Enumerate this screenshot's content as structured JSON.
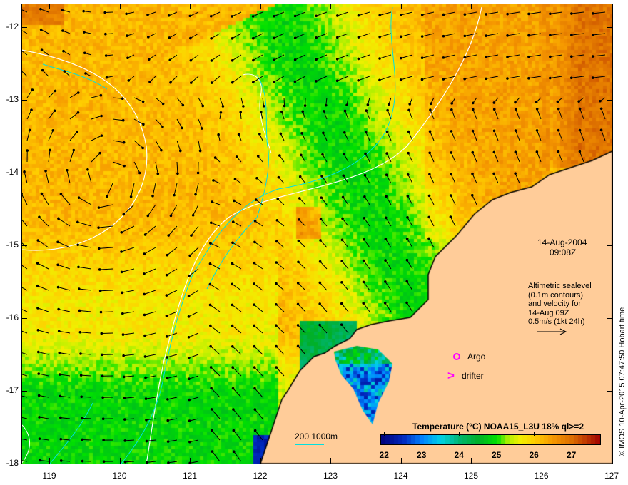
{
  "map": {
    "lat_labels": [
      "-12",
      "-13",
      "-14",
      "-15",
      "-16",
      "-17",
      "-18"
    ],
    "lon_labels": [
      "119",
      "120",
      "121",
      "122",
      "123",
      "124",
      "125",
      "126",
      "127"
    ],
    "lat_values": [
      -12,
      -13,
      -14,
      -15,
      -16,
      -17,
      -18
    ],
    "lon_values": [
      119,
      120,
      121,
      122,
      123,
      124,
      125,
      126,
      127
    ],
    "land_color": "#FFCC99"
  },
  "annotations": {
    "date": "14-Aug-2004",
    "time": "09:08Z",
    "altimetry": [
      "Altimetric sealevel",
      "(0.1m contours)",
      "and velocity for",
      "14-Aug 09Z",
      "0.5m/s (1kt 24h)"
    ],
    "argo_label": "Argo",
    "drifter_label": "drifter",
    "drifter_symbol": ">",
    "depth_scale": "200  1000m",
    "credit": "© IMOS 10-Apr-2015 07:47:50 Hobart time",
    "marker_color": "#FF00FF"
  },
  "legend": {
    "title": "Temperature (°C) NOAA15_L3U 18% ql>=2",
    "ticks": [
      "22",
      "23",
      "24",
      "25",
      "26",
      "27"
    ],
    "tick_values": [
      22,
      23,
      24,
      25,
      26,
      27
    ],
    "range": [
      21.9,
      27.75
    ]
  }
}
